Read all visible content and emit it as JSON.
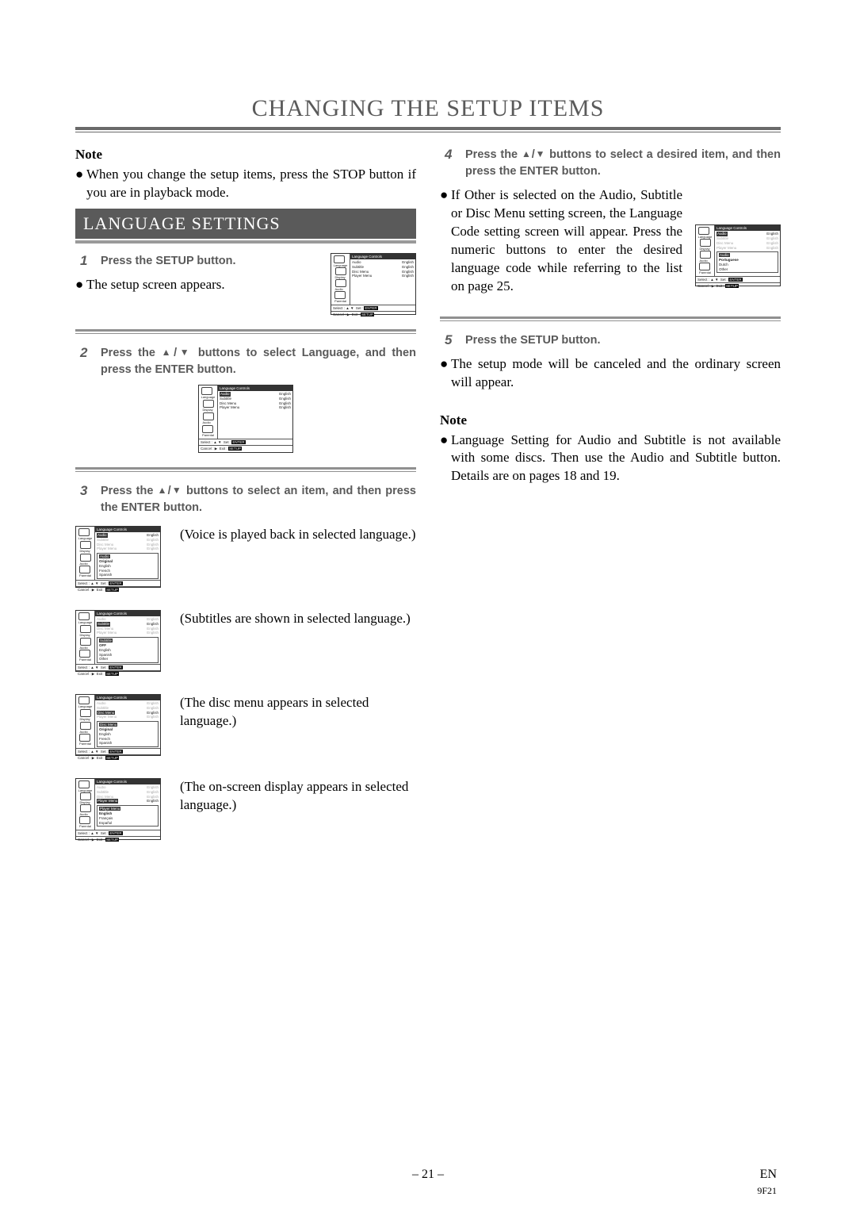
{
  "page_title": "CHANGING THE SETUP ITEMS",
  "section_banner": "LANGUAGE SETTINGS",
  "left": {
    "note_head": "Note",
    "note_body": "When you change the setup items, press the STOP button if you are in playback mode.",
    "step1": {
      "num": "1",
      "text": "Press the SETUP button."
    },
    "step1_sub": "The setup screen appears.",
    "step2": {
      "num": "2",
      "text_a": "Press the ",
      "text_b": " buttons to select Language, and then press the ENTER button."
    },
    "step3": {
      "num": "3",
      "text_a": "Press the ",
      "text_b": " buttons to select an item, and then press the ENTER button."
    },
    "items": [
      {
        "highlightRow": "Audio",
        "dropdownTitle": "Audio",
        "options": [
          "Original",
          "English",
          "French",
          "Spanish"
        ],
        "desc": "(Voice is played back in selected language.)"
      },
      {
        "highlightRow": "Subtitle",
        "dropdownTitle": "Subtitle",
        "options": [
          "OFF",
          "English",
          "Spanish",
          "Other"
        ],
        "desc": "(Subtitles are shown in selected language.)"
      },
      {
        "highlightRow": "Disc Menu",
        "dropdownTitle": "Disc Menu",
        "options": [
          "Original",
          "English",
          "French",
          "Spanish"
        ],
        "desc": "(The disc menu appears in selected language.)"
      },
      {
        "highlightRow": "Player Menu",
        "dropdownTitle": "Player Menu",
        "options": [
          "English",
          "Français",
          "Español"
        ],
        "desc": "(The on-screen display appears in selected language.)"
      }
    ]
  },
  "right": {
    "step4": {
      "num": "4",
      "text_a": "Press the ",
      "text_b": " buttons to select a desired item, and then press the ENTER button."
    },
    "step4_para": "If Other is selected on the Audio, Subtitle or Disc Menu setting screen, the Language Code setting screen will appear. Press the numeric buttons to enter the desired language code while referring to the list on page 25.",
    "step5": {
      "num": "5",
      "text": "Press the SETUP button."
    },
    "step5_para": "The setup mode will be canceled and the ordinary screen will appear.",
    "note_head": "Note",
    "note_body": "Language Setting for Audio and Subtitle is not available with some discs. Then use the Audio and Subtitle button. Details are on pages 18 and 19."
  },
  "osd": {
    "title": "Language Controls",
    "rows": [
      {
        "k": "Audio",
        "v": "English"
      },
      {
        "k": "Subtitle",
        "v": "English"
      },
      {
        "k": "Disc Menu",
        "v": "English"
      },
      {
        "k": "Player Menu",
        "v": "English"
      }
    ],
    "side_labels": [
      "Language",
      "Display",
      "Audio",
      "Parental"
    ],
    "foot_select": "Select :",
    "foot_set": "Set :",
    "foot_enter": "ENTER",
    "foot_cancel": "Cancel :",
    "foot_exit": "Exit :",
    "foot_setup": "SETUP",
    "right_popup_title": "Audio",
    "right_popup_options": [
      "Portuguese",
      "Dutch",
      "Other"
    ]
  },
  "footer": {
    "page": "– 21 –",
    "lang": "EN",
    "code": "9F21"
  },
  "glyphs": {
    "up": "▲",
    "down": "▼",
    "bullet": "●"
  }
}
